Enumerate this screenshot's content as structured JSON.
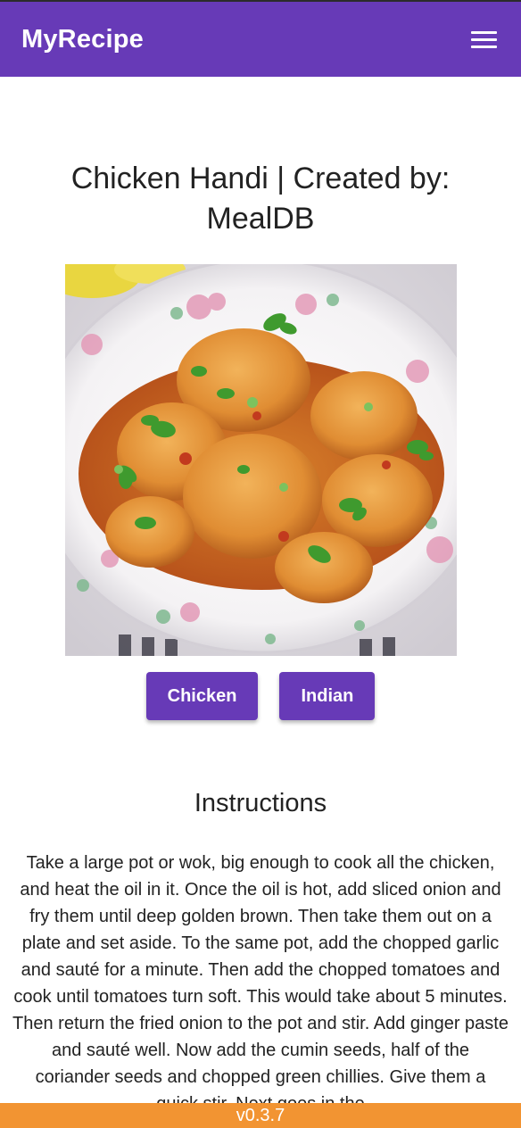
{
  "app": {
    "brand": "MyRecipe",
    "menu_icon": "hamburger-menu-icon",
    "accent_color": "#673ab7",
    "footer_color": "#f29432"
  },
  "recipe": {
    "title": "Chicken Handi | Created by: MealDB",
    "image_description_icon": "meal-photo",
    "tags": [
      "Chicken",
      "Indian"
    ]
  },
  "instructions": {
    "heading": "Instructions",
    "text": "Take a large pot or wok, big enough to cook all the chicken, and heat the oil in it. Once the oil is hot, add sliced onion and fry them until deep golden brown. Then take them out on a plate and set aside. To the same pot, add the chopped garlic and sauté for a minute. Then add the chopped tomatoes and cook until tomatoes turn soft. This would take about 5 minutes. Then return the fried onion to the pot and stir. Add ginger paste and sauté well. Now add the cumin seeds, half of the coriander seeds and chopped green chillies. Give them a quick stir. Next goes in the"
  },
  "footer": {
    "version": "v0.3.7"
  }
}
